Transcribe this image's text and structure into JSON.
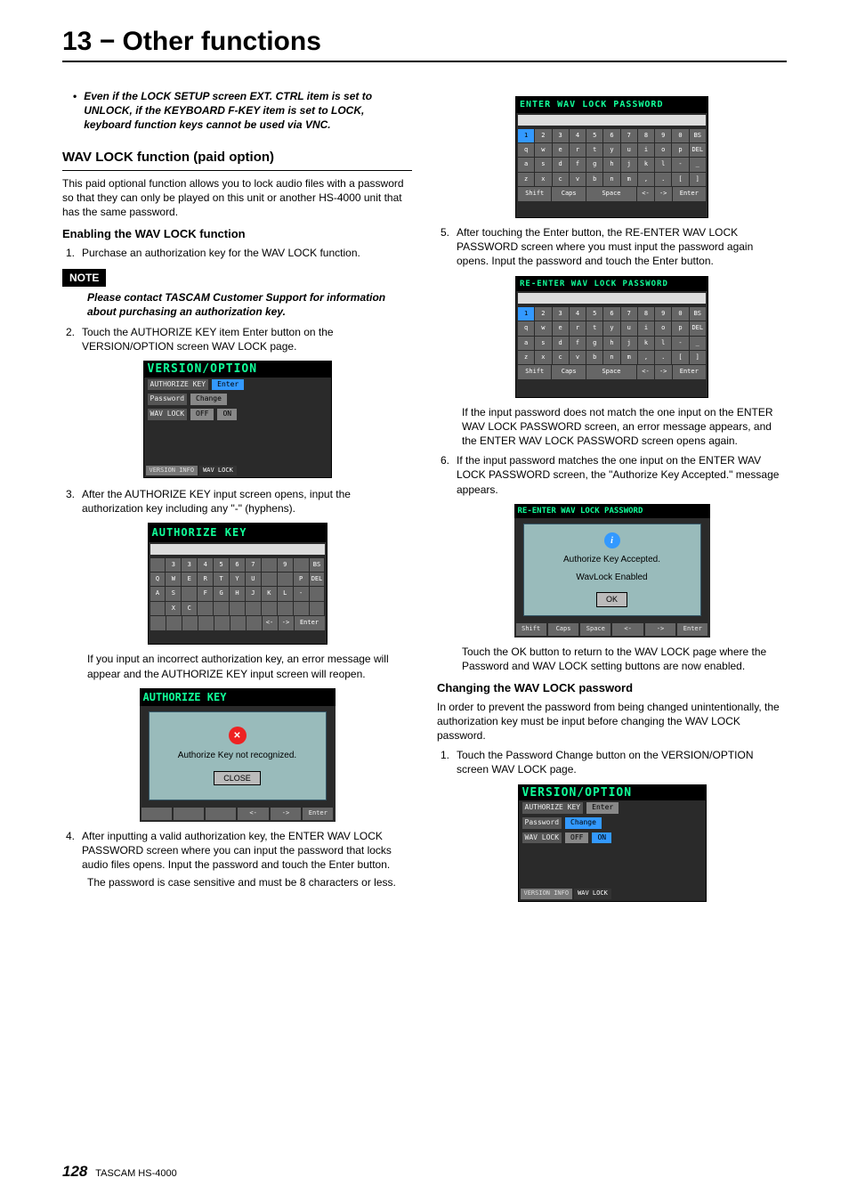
{
  "chapter": "13 − Other functions",
  "footer": {
    "page": "128",
    "product": "TASCAM  HS-4000"
  },
  "left": {
    "top_bullet": "Even if the LOCK SETUP screen EXT. CTRL item is set to UNLOCK, if the KEYBOARD F-KEY item is set to LOCK, keyboard function keys cannot be used via VNC.",
    "section": "WAV LOCK function (paid option)",
    "section_body": "This paid optional function allows you to lock audio files with a password so that they can only be played on this unit or another HS-4000 unit that has the same password.",
    "sub1": "Enabling the WAV LOCK function",
    "item1": {
      "n": "1.",
      "t": "Purchase an authorization key for the WAV LOCK function."
    },
    "note_label": "NOTE",
    "note_body": "Please contact TASCAM Customer Support for information about purchasing an authorization key.",
    "item2": {
      "n": "2.",
      "t": "Touch the AUTHORIZE KEY item Enter button on the VERSION/OPTION screen WAV LOCK page."
    },
    "fig1": {
      "title": "VERSION/OPTION",
      "r1": "AUTHORIZE KEY",
      "b1": "Enter",
      "r2": "Password",
      "b2": "Change",
      "r3": "WAV LOCK",
      "b3a": "OFF",
      "b3b": "ON",
      "tab1": "VERSION INFO",
      "tab2": "WAV LOCK"
    },
    "item3": {
      "n": "3.",
      "t": "After the AUTHORIZE KEY input screen opens, input the authorization key including any \"-\" (hyphens)."
    },
    "kb1": {
      "title": "AUTHORIZE KEY",
      "rows": [
        [
          "",
          "3",
          "3",
          "4",
          "5",
          "6",
          "7",
          "",
          "9",
          "",
          "BS"
        ],
        [
          "Q",
          "W",
          "E",
          "R",
          "T",
          "Y",
          "U",
          "",
          "",
          "P",
          "DEL"
        ],
        [
          "A",
          "S",
          "",
          "F",
          "G",
          "H",
          "J",
          "K",
          "L",
          "-",
          ""
        ],
        [
          "",
          "X",
          "C",
          "",
          "",
          "",
          "",
          "",
          "",
          "",
          ""
        ]
      ],
      "bottom": [
        "",
        "",
        "",
        "",
        "",
        "",
        "",
        "<-",
        "->",
        "Enter"
      ]
    },
    "after3": "If you input an incorrect authorization key, an error message will appear and the AUTHORIZE KEY input screen will reopen.",
    "msg1": {
      "title": "AUTHORIZE KEY",
      "text": "Authorize Key not recognized.",
      "btn": "CLOSE"
    },
    "item4": {
      "n": "4.",
      "t": "After inputting a valid authorization key, the ENTER WAV LOCK PASSWORD screen where you can input the password that locks audio files opens. Input the password and touch the Enter button."
    },
    "after4": "The password is case sensitive and must be 8 characters or less."
  },
  "right": {
    "kbA": {
      "title": "ENTER WAV LOCK PASSWORD",
      "rows": [
        [
          "1",
          "2",
          "3",
          "4",
          "5",
          "6",
          "7",
          "8",
          "9",
          "0",
          "BS"
        ],
        [
          "q",
          "w",
          "e",
          "r",
          "t",
          "y",
          "u",
          "i",
          "o",
          "p",
          "DEL"
        ],
        [
          "a",
          "s",
          "d",
          "f",
          "g",
          "h",
          "j",
          "k",
          "l",
          "-",
          "_"
        ],
        [
          "z",
          "x",
          "c",
          "v",
          "b",
          "n",
          "m",
          ",",
          ".",
          "[",
          "]"
        ]
      ],
      "bottom": [
        "Shift",
        "Caps",
        "Space",
        "<-",
        "->",
        "Enter"
      ]
    },
    "item5": {
      "n": "5.",
      "t": "After touching the Enter button, the RE-ENTER WAV LOCK PASSWORD screen where you must input the password again opens. Input the password and touch the Enter button."
    },
    "kbB": {
      "title": "RE-ENTER WAV LOCK PASSWORD",
      "rows": [
        [
          "1",
          "2",
          "3",
          "4",
          "5",
          "6",
          "7",
          "8",
          "9",
          "0",
          "BS"
        ],
        [
          "q",
          "w",
          "e",
          "r",
          "t",
          "y",
          "u",
          "i",
          "o",
          "p",
          "DEL"
        ],
        [
          "a",
          "s",
          "d",
          "f",
          "g",
          "h",
          "j",
          "k",
          "l",
          "-",
          "_"
        ],
        [
          "z",
          "x",
          "c",
          "v",
          "b",
          "n",
          "m",
          ",",
          ".",
          "[",
          "]"
        ]
      ],
      "bottom": [
        "Shift",
        "Caps",
        "Space",
        "<-",
        "->",
        "Enter"
      ]
    },
    "after5": "If the input password does not match the one input on the ENTER WAV LOCK PASSWORD screen, an error message appears, and the ENTER WAV LOCK PASSWORD screen opens again.",
    "item6": {
      "n": "6.",
      "t": "If the input password matches the one input on the ENTER WAV LOCK PASSWORD screen, the \"Authorize Key Accepted.\" message appears."
    },
    "msg2": {
      "title": "RE-ENTER WAV LOCK PASSWORD",
      "line1": "Authorize Key Accepted.",
      "line2": "WavLock Enabled",
      "btn": "OK"
    },
    "after6": "Touch the OK button to return to the WAV LOCK page where the Password and WAV LOCK setting buttons are now enabled.",
    "sub2": "Changing the WAV LOCK password",
    "sub2_body": "In order to prevent the password from being changed unintentionally, the authorization key must be input before changing the WAV LOCK password.",
    "itemC1": {
      "n": "1.",
      "t": "Touch the Password Change button on the VERSION/OPTION screen WAV LOCK page."
    },
    "fig2": {
      "title": "VERSION/OPTION",
      "r1": "AUTHORIZE KEY",
      "b1": "Enter",
      "r2": "Password",
      "b2": "Change",
      "r3": "WAV LOCK",
      "b3a": "OFF",
      "b3b": "ON",
      "tab1": "VERSION INFO",
      "tab2": "WAV LOCK"
    }
  }
}
